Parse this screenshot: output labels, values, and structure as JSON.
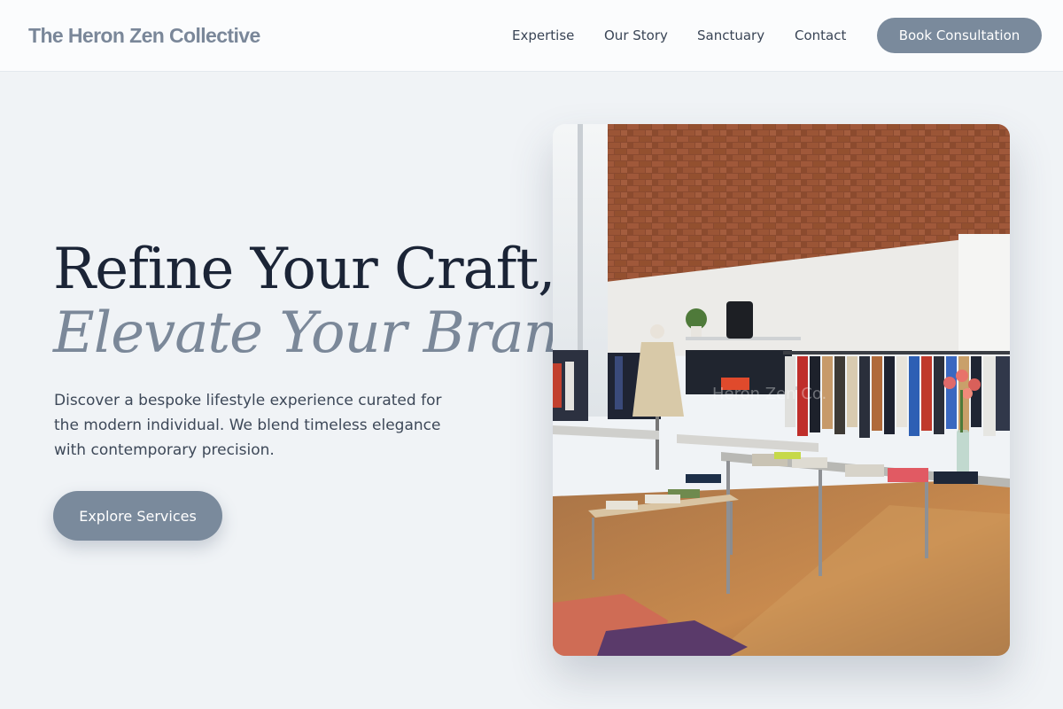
{
  "brand": {
    "name": "The Heron Zen Collective"
  },
  "nav": {
    "items": [
      {
        "label": "Expertise"
      },
      {
        "label": "Our Story"
      },
      {
        "label": "Sanctuary"
      },
      {
        "label": "Contact"
      }
    ],
    "cta_label": "Book Consultation"
  },
  "hero": {
    "headline_line1": "Refine Your Craft,",
    "headline_line2": "Elevate Your Brand.",
    "body": "Discover a bespoke lifestyle experience curated for the modern individual. We blend timeless elegance with contemporary precision.",
    "button_label": "Explore Services",
    "image": {
      "alt": "Boutique clothing store interior with brick wall, clothing racks and display tables",
      "watermark": "Heron Zen Co."
    }
  },
  "colors": {
    "accent": "#7a8a9c",
    "background": "#f0f3f6",
    "heading": "#1b2436",
    "muted_heading": "#7b8899"
  }
}
